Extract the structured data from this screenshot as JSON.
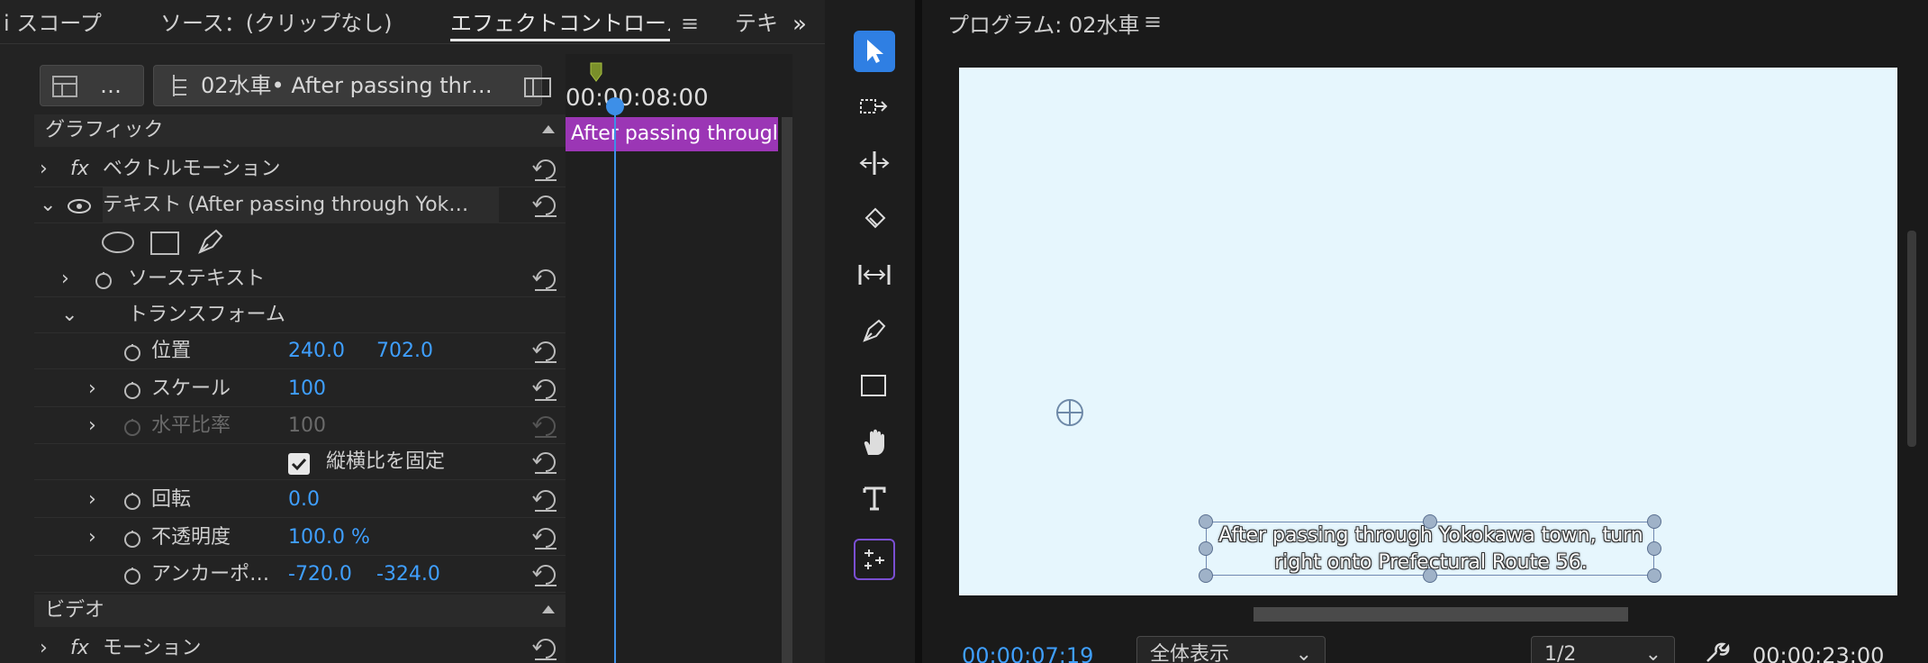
{
  "tabs": {
    "scope": "i スコープ",
    "source": "ソース：(クリップなし)",
    "effect_controls": "エフェクトコントロール",
    "text": "テキ"
  },
  "header": {
    "master_label": "…",
    "clip_label": "02水車• After passing thr…"
  },
  "mini_timeline": {
    "timecode": "00:00:08:00",
    "clip_label": "After passing through"
  },
  "sections": {
    "graphics": "グラフィック",
    "video": "ビデオ"
  },
  "rows": {
    "vector_motion": "ベクトルモーション",
    "text_layer": "テキスト (After passing through Yok…",
    "source_text": "ソーステキスト",
    "transform": "トランスフォーム",
    "position": {
      "label": "位置",
      "x": "240.0",
      "y": "702.0"
    },
    "scale": {
      "label": "スケール",
      "value": "100"
    },
    "scale_width": {
      "label": "水平比率",
      "value": "100"
    },
    "uniform_scale": {
      "label": "縦横比を固定",
      "checked": true
    },
    "rotation": {
      "label": "回転",
      "value": "0.0"
    },
    "opacity": {
      "label": "不透明度",
      "value": "100.0 %"
    },
    "anchor": {
      "label": "アンカーポ…",
      "x": "-720.0",
      "y": "-324.0"
    },
    "motion": "モーション"
  },
  "program": {
    "title": "プログラム: 02水車",
    "caption_line1": "After passing through Yokokawa town, turn",
    "caption_line2": "right onto Prefectural Route 56.",
    "current_time": "00:00:07:19",
    "zoom": "全体表示",
    "resolution": "1/2",
    "duration": "00:00:23:00"
  },
  "colors": {
    "accent_blue": "#2f7fe3",
    "value_blue": "#3f9fff",
    "clip_purple": "#9b36b5",
    "frame_bg": "#e6f6fd"
  }
}
